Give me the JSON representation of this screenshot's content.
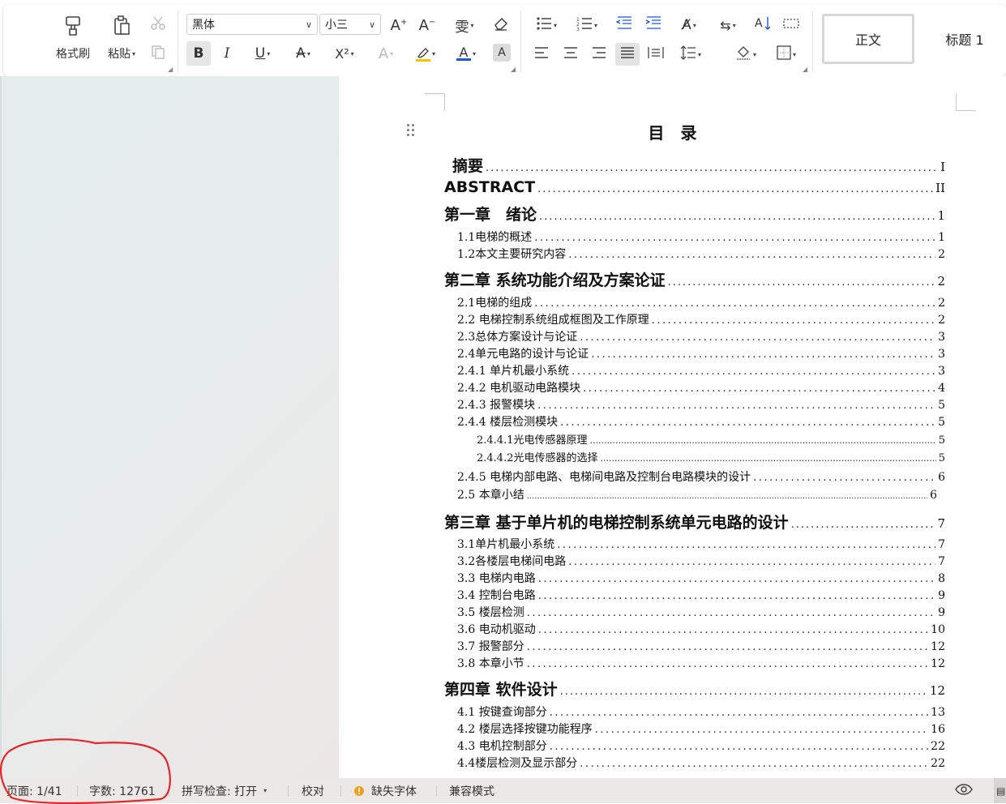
{
  "ribbon": {
    "clipboard": {
      "format_painter": "格式刷",
      "paste": "粘贴"
    },
    "font": {
      "family": "黑体",
      "size": "小三"
    },
    "format_labels": {
      "bold": "B",
      "italic": "I",
      "underline": "U",
      "strike": "A",
      "super": "X²",
      "font_color": "A",
      "shade": "A"
    },
    "styles": {
      "normal": "正文",
      "heading1": "标题 1"
    }
  },
  "document": {
    "title": "目　录",
    "toc": [
      {
        "level": 1,
        "text": "摘要",
        "page": "I"
      },
      {
        "level": 1,
        "text": "ABSTRACT",
        "page": "II"
      },
      {
        "level": 1,
        "text": "第一章　绪论",
        "page": "1"
      },
      {
        "level": 2,
        "text": "1.1电梯的概述",
        "page": "1"
      },
      {
        "level": 2,
        "text": "1.2本文主要研究内容",
        "page": "2"
      },
      {
        "level": 1,
        "text": "第二章 系统功能介绍及方案论证",
        "page": "2"
      },
      {
        "level": 2,
        "text": "2.1电梯的组成",
        "page": "2"
      },
      {
        "level": 2,
        "text": "2.2 电梯控制系统组成框图及工作原理",
        "page": "2"
      },
      {
        "level": 2,
        "text": "2.3总体方案设计与论证",
        "page": "3"
      },
      {
        "level": 2,
        "text": "2.4单元电路的设计与论证",
        "page": "3"
      },
      {
        "level": 2,
        "text": "2.4.1 单片机最小系统",
        "page": "3"
      },
      {
        "level": 2,
        "text": "2.4.2 电机驱动电路模块",
        "page": "4"
      },
      {
        "level": 2,
        "text": "2.4.3 报警模块",
        "page": "5"
      },
      {
        "level": 2,
        "text": "2.4.4 楼层检测模块",
        "page": "5"
      },
      {
        "level": 3,
        "text": "2.4.4.1光电传感器原理",
        "page": "5"
      },
      {
        "level": 3,
        "text": "2.4.4.2光电传感器的选择",
        "page": "5"
      },
      {
        "level": 2,
        "text": "2.4.5 电梯内部电路、电梯间电路及控制台电路模块的设计",
        "page": "6"
      },
      {
        "level": 4,
        "text": "2.5 本章小结",
        "page": "6"
      },
      {
        "level": 1,
        "text": "第三章 基于单片机的电梯控制系统单元电路的设计",
        "page": "7"
      },
      {
        "level": 2,
        "text": "3.1单片机最小系统",
        "page": "7"
      },
      {
        "level": 2,
        "text": "3.2各楼层电梯间电路",
        "page": "7"
      },
      {
        "level": 2,
        "text": "3.3 电梯内电路",
        "page": "8"
      },
      {
        "level": 2,
        "text": "3.4 控制台电路",
        "page": "9"
      },
      {
        "level": 2,
        "text": "3.5 楼层检测",
        "page": "9"
      },
      {
        "level": 2,
        "text": "3.6 电动机驱动",
        "page": "10"
      },
      {
        "level": 2,
        "text": "3.7 报警部分",
        "page": "12"
      },
      {
        "level": 2,
        "text": "3.8 本章小节",
        "page": "12"
      },
      {
        "level": 1,
        "text": "第四章 软件设计",
        "page": "12"
      },
      {
        "level": 2,
        "text": "4.1 按键查询部分",
        "page": "13"
      },
      {
        "level": 2,
        "text": "4.2 楼层选择按键功能程序",
        "page": "16"
      },
      {
        "level": 2,
        "text": "4.3 电机控制部分",
        "page": "22"
      },
      {
        "level": 2,
        "text": "4.4楼层检测及显示部分",
        "page": "22"
      }
    ]
  },
  "statusbar": {
    "page": "页面: 1/41",
    "words": "字数: 12761",
    "spell": "拼写检查: 打开",
    "proof": "校对",
    "missing_font": "缺失字体",
    "compat": "兼容模式"
  },
  "colors": {
    "annotation": "#e5262b",
    "font_color_bar": "#1e56d8",
    "highlight_bar": "#f4c400",
    "missing_font_warning": "#f0a020"
  }
}
